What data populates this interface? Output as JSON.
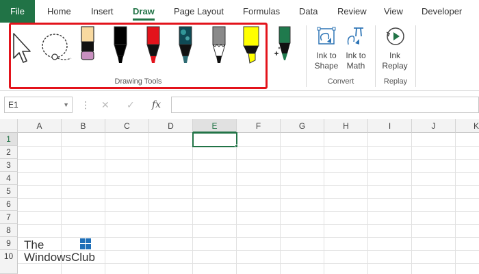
{
  "tabs": {
    "file": "File",
    "home": "Home",
    "insert": "Insert",
    "draw": "Draw",
    "page_layout": "Page Layout",
    "formulas": "Formulas",
    "data": "Data",
    "review": "Review",
    "view": "View",
    "developer": "Developer"
  },
  "ribbon": {
    "drawing_tools_label": "Drawing Tools",
    "tools": [
      {
        "icon": "select-arrow-icon"
      },
      {
        "icon": "lasso-select-icon"
      },
      {
        "icon": "pencil-pink-icon",
        "color": "#c990c0"
      },
      {
        "icon": "pen-black-icon",
        "color": "#000000"
      },
      {
        "icon": "pen-red-icon",
        "color": "#e3131b"
      },
      {
        "icon": "pen-galaxy-icon",
        "color": "#2e6b73"
      },
      {
        "icon": "pen-silver-icon",
        "color": "#8a8a8a"
      },
      {
        "icon": "highlighter-yellow-icon",
        "color": "#ffff00"
      }
    ],
    "add_pen_icon": "add-pen-icon",
    "ink_to_shape": "Ink to Shape",
    "ink_to_shape_line1": "Ink to",
    "ink_to_shape_line2": "Shape",
    "ink_to_math_line1": "Ink to",
    "ink_to_math_line2": "Math",
    "convert_label": "Convert",
    "ink_replay_line1": "Ink",
    "ink_replay_line2": "Replay",
    "replay_label": "Replay"
  },
  "formula_bar": {
    "name_box": "E1",
    "cancel": "✕",
    "enter": "✓",
    "fx": "fx",
    "value": ""
  },
  "grid": {
    "columns": [
      "A",
      "B",
      "C",
      "D",
      "E",
      "F",
      "G",
      "H",
      "I",
      "J",
      "K"
    ],
    "rows": [
      "1",
      "2",
      "3",
      "4",
      "5",
      "6",
      "7",
      "8",
      "9",
      "10"
    ],
    "selected_cell": "E1"
  },
  "watermark": {
    "line1": "The",
    "line2": "WindowsClub"
  },
  "colors": {
    "accent": "#217346",
    "highlight": "#e3131b",
    "convert_icon": "#2e75b6"
  }
}
